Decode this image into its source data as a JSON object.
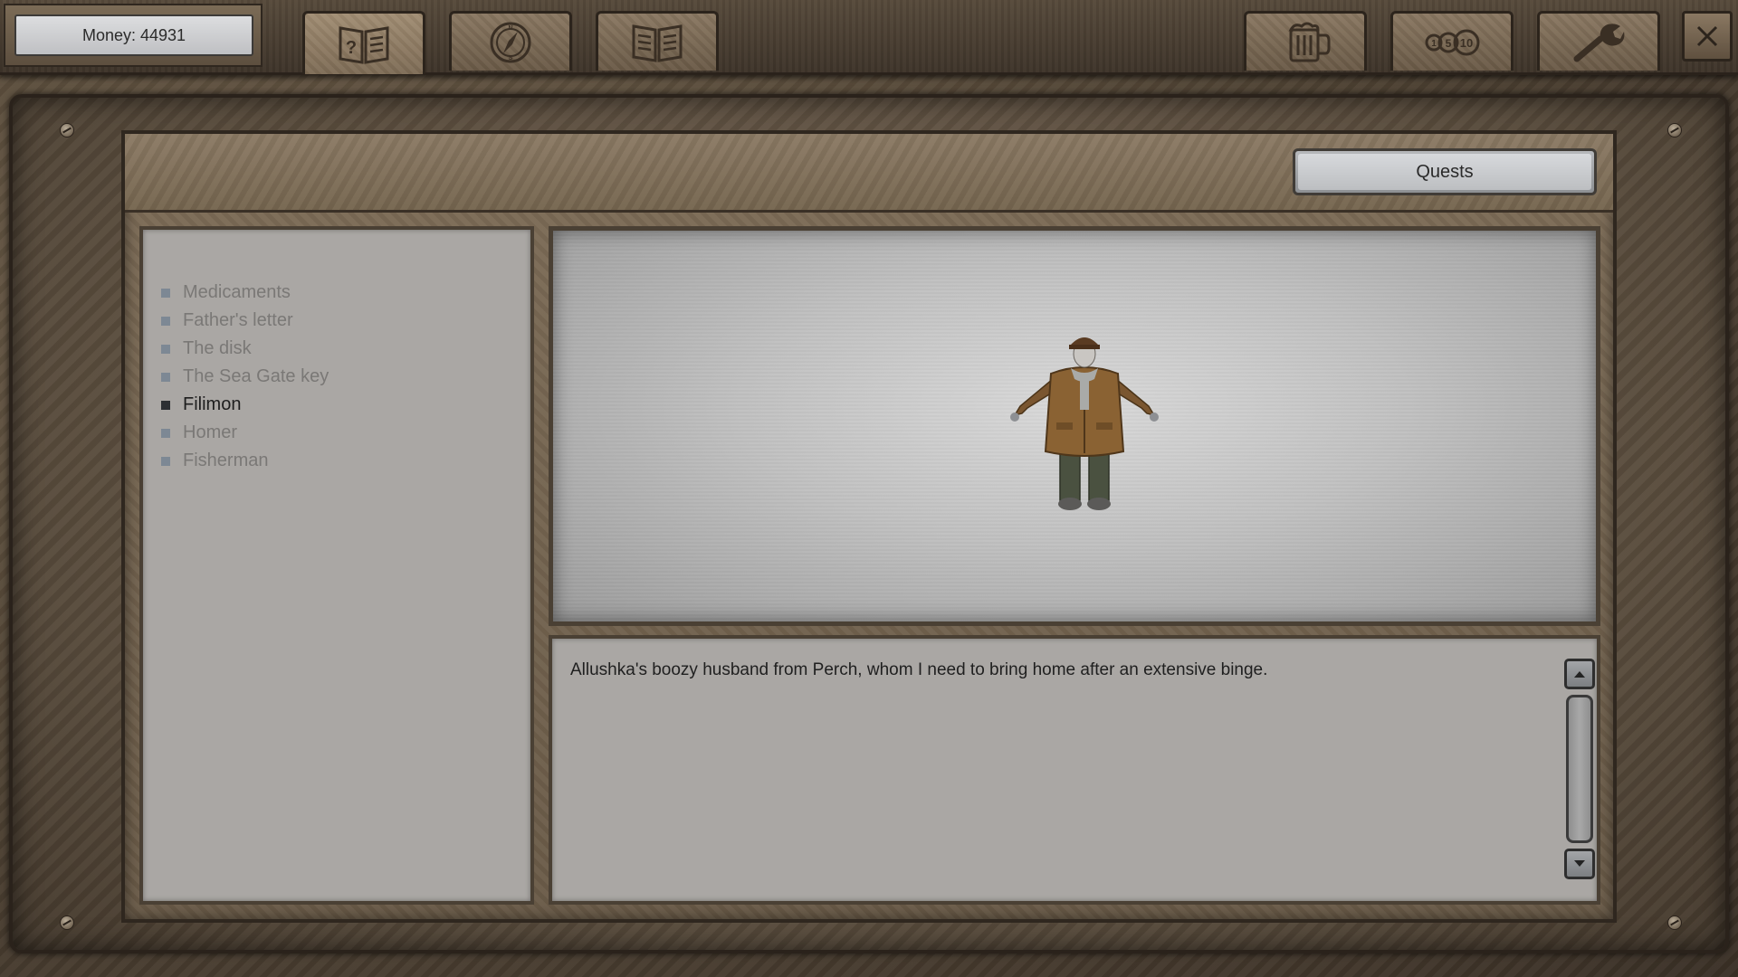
{
  "topbar": {
    "money_label": "Money: 44931",
    "tabs": [
      {
        "icon": "quest-journal-icon",
        "active": true
      },
      {
        "icon": "compass-map-icon",
        "active": false
      },
      {
        "icon": "open-book-icon",
        "active": false
      },
      {
        "icon": "beer-mug-icon",
        "active": false
      },
      {
        "icon": "coins-icon",
        "active": false
      },
      {
        "icon": "wrench-icon",
        "active": false
      }
    ],
    "close_icon": "close-icon"
  },
  "journal": {
    "category_button": "Quests",
    "entries": [
      {
        "label": "Medicaments",
        "selected": false
      },
      {
        "label": "Father's letter",
        "selected": false
      },
      {
        "label": "The disk",
        "selected": false
      },
      {
        "label": "The Sea Gate key",
        "selected": false
      },
      {
        "label": "Filimon",
        "selected": true
      },
      {
        "label": "Homer",
        "selected": false
      },
      {
        "label": "Fisherman",
        "selected": false
      }
    ],
    "description": "Allushka's boozy husband from Perch, whom I need to bring home after an extensive binge."
  },
  "colors": {
    "frame_brown": "#574a3b",
    "panel_gray": "#aaa7a4",
    "text_dim": "#7a7876",
    "text_selected": "#1e1e1e"
  }
}
